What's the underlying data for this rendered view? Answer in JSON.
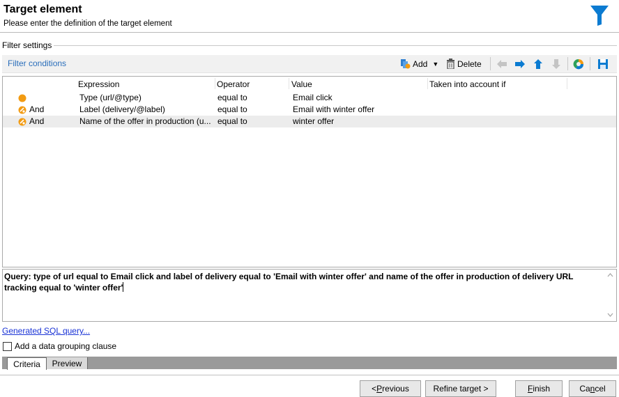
{
  "header": {
    "title": "Target element",
    "subtitle": "Please enter the definition of the target element"
  },
  "filter_settings": {
    "label": "Filter settings",
    "conditions_link": "Filter conditions",
    "toolbar": {
      "add_label": "Add",
      "delete_label": "Delete"
    }
  },
  "grid": {
    "columns": [
      "Expression",
      "Operator",
      "Value",
      "Taken into account if"
    ],
    "rows": [
      {
        "connector": "",
        "expression": "Type (url/@type)",
        "operator": "equal to",
        "value": "Email click",
        "taken": ""
      },
      {
        "connector": "And",
        "expression": "Label (delivery/@label)",
        "operator": "equal to",
        "value": "Email with winter offer",
        "taken": ""
      },
      {
        "connector": "And",
        "expression": "Name of the offer in production (u...",
        "operator": "equal to",
        "value": "winter offer",
        "taken": ""
      }
    ]
  },
  "query": {
    "text": "Query: type of url equal to Email click and label of delivery equal to 'Email with winter offer' and name of the offer in production of delivery URL tracking equal to 'winter offer'"
  },
  "links": {
    "generated_sql": "Generated SQL query..."
  },
  "grouping": {
    "label": "Add a data grouping clause",
    "checked": false
  },
  "tabs": [
    {
      "label": "Criteria",
      "active": true
    },
    {
      "label": "Preview",
      "active": false
    }
  ],
  "buttons": {
    "previous": {
      "pre": "< ",
      "mnemonic": "P",
      "rest": "revious"
    },
    "refine": "Refine target >",
    "finish": {
      "mnemonic": "F",
      "rest": "inish"
    },
    "cancel": {
      "pre": "Ca",
      "mnemonic": "n",
      "rest": "cel"
    }
  },
  "colors": {
    "accent": "#0b7bd1",
    "link": "#2a6ebb",
    "condition_dot": "#f29b12"
  }
}
